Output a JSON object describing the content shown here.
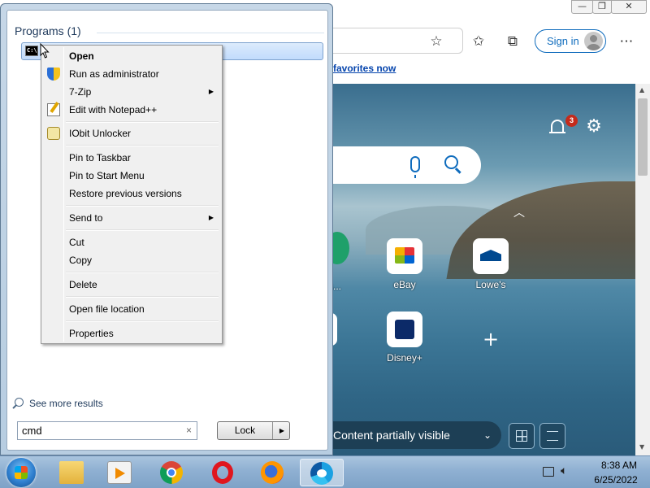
{
  "browser": {
    "window_buttons": {
      "minimize": "—",
      "maximize": "❐",
      "close": "✕"
    },
    "signin_label": "Sign in",
    "favorites_link": "favorites now",
    "notification_count": "3",
    "tiles": [
      {
        "label": "eBay"
      },
      {
        "label": "Lowe's"
      },
      {
        "label": "Disney+"
      }
    ],
    "partial_tile_label": "s...",
    "content_status": "Content partially visible",
    "accent_color": "#0f6cbd"
  },
  "start_menu": {
    "programs_heading": "Programs (1)",
    "result_label": "cmd",
    "see_more": "See more results",
    "search_value": "cmd",
    "clear_glyph": "×",
    "lock_label": "Lock",
    "lock_arrow": "▶"
  },
  "context_menu": {
    "items": [
      {
        "label": "Open",
        "bold": true,
        "icon": ""
      },
      {
        "label": "Run as administrator",
        "icon": "shield-icon"
      },
      {
        "label": "7-Zip",
        "submenu": true,
        "icon": ""
      },
      {
        "label": "Edit with Notepad++",
        "icon": "notepad-plus-icon"
      },
      {
        "label": "IObit Unlocker",
        "icon": "iobit-unlocker-icon"
      },
      {
        "label": "Pin to Taskbar"
      },
      {
        "label": "Pin to Start Menu"
      },
      {
        "label": "Restore previous versions"
      },
      {
        "label": "Send to",
        "submenu": true
      },
      {
        "label": "Cut"
      },
      {
        "label": "Copy"
      },
      {
        "label": "Delete"
      },
      {
        "label": "Open file location"
      },
      {
        "label": "Properties"
      }
    ],
    "submenu_glyph": "▶"
  },
  "taskbar": {
    "apps": [
      "windows-explorer",
      "media-player",
      "chrome",
      "opera",
      "firefox",
      "edge"
    ],
    "time": "8:38 AM",
    "date": "6/25/2022"
  }
}
